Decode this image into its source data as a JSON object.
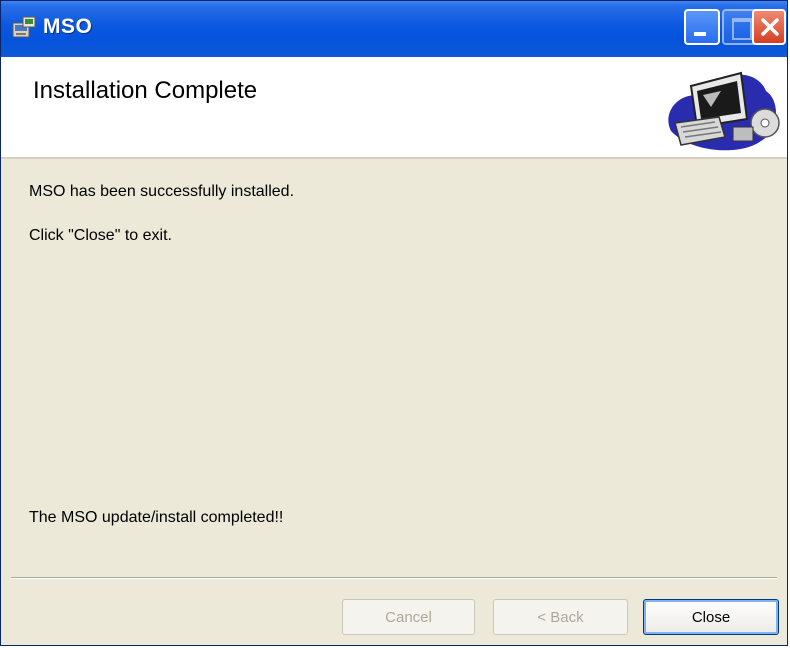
{
  "window": {
    "title": "MSO",
    "app_icon": "installer-icon",
    "controls": {
      "minimize": "minimize-icon",
      "maximize": "maximize-icon",
      "close": "close-icon"
    }
  },
  "banner": {
    "heading": "Installation Complete",
    "image": "computer-setup-icon"
  },
  "body": {
    "line1": "MSO has been successfully installed.",
    "line2": "Click \"Close\" to exit.",
    "line3": "The MSO update/install completed!!"
  },
  "buttons": {
    "cancel": {
      "label": "Cancel",
      "enabled": false
    },
    "back": {
      "label": "< Back",
      "enabled": false
    },
    "close": {
      "label": "Close",
      "enabled": true
    }
  },
  "colors": {
    "titlebar": "#0553dc",
    "dialog_background": "#ece9d8",
    "close_button": "#d43f25"
  }
}
